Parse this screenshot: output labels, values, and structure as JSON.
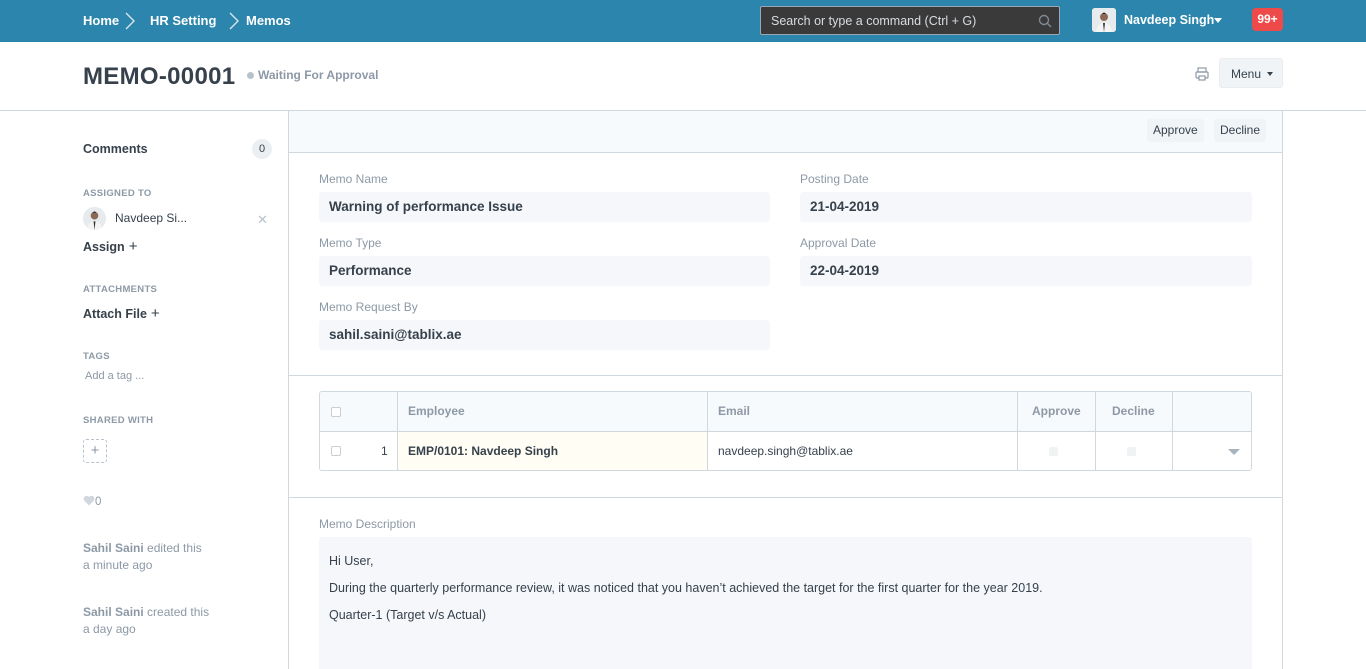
{
  "navbar": {
    "breadcrumbs": [
      "Home",
      "HR Setting",
      "Memos"
    ],
    "search_placeholder": "Search or type a command (Ctrl + G)",
    "user_name": "Navdeep Singh",
    "notifications": "99+"
  },
  "header": {
    "title": "MEMO-00001",
    "status": "Waiting For Approval",
    "menu_label": "Menu"
  },
  "sidebar": {
    "comments_label": "Comments",
    "comments_count": "0",
    "assigned_to_label": "ASSIGNED TO",
    "assigned_user": "Navdeep Si...",
    "assign_label": "Assign",
    "attachments_label": "ATTACHMENTS",
    "attach_file_label": "Attach File",
    "tags_label": "TAGS",
    "add_tag_placeholder": "Add a tag ...",
    "shared_with_label": "SHARED WITH",
    "likes": "0",
    "timeline": [
      {
        "user": "Sahil Saini",
        "action": "edited this",
        "time": "a minute ago"
      },
      {
        "user": "Sahil Saini",
        "action": "created this",
        "time": "a day ago"
      }
    ]
  },
  "actions": {
    "approve": "Approve",
    "decline": "Decline"
  },
  "fields": {
    "memo_name_label": "Memo Name",
    "memo_name": "Warning of performance Issue",
    "posting_date_label": "Posting Date",
    "posting_date": "21-04-2019",
    "memo_type_label": "Memo Type",
    "memo_type": "Performance",
    "approval_date_label": "Approval Date",
    "approval_date": "22-04-2019",
    "request_by_label": "Memo Request By",
    "request_by": "sahil.saini@tablix.ae"
  },
  "table": {
    "columns": [
      "Employee",
      "Email",
      "Approve",
      "Decline"
    ],
    "rows": [
      {
        "idx": "1",
        "employee": "EMP/0101: Navdeep Singh",
        "email": "navdeep.singh@tablix.ae"
      }
    ]
  },
  "description": {
    "label": "Memo Description",
    "lines": [
      "Hi User,",
      "During the quarterly performance review, it was noticed that you haven’t achieved the target for the first quarter for the year 2019.",
      "Quarter-1 (Target v/s Actual)"
    ]
  }
}
